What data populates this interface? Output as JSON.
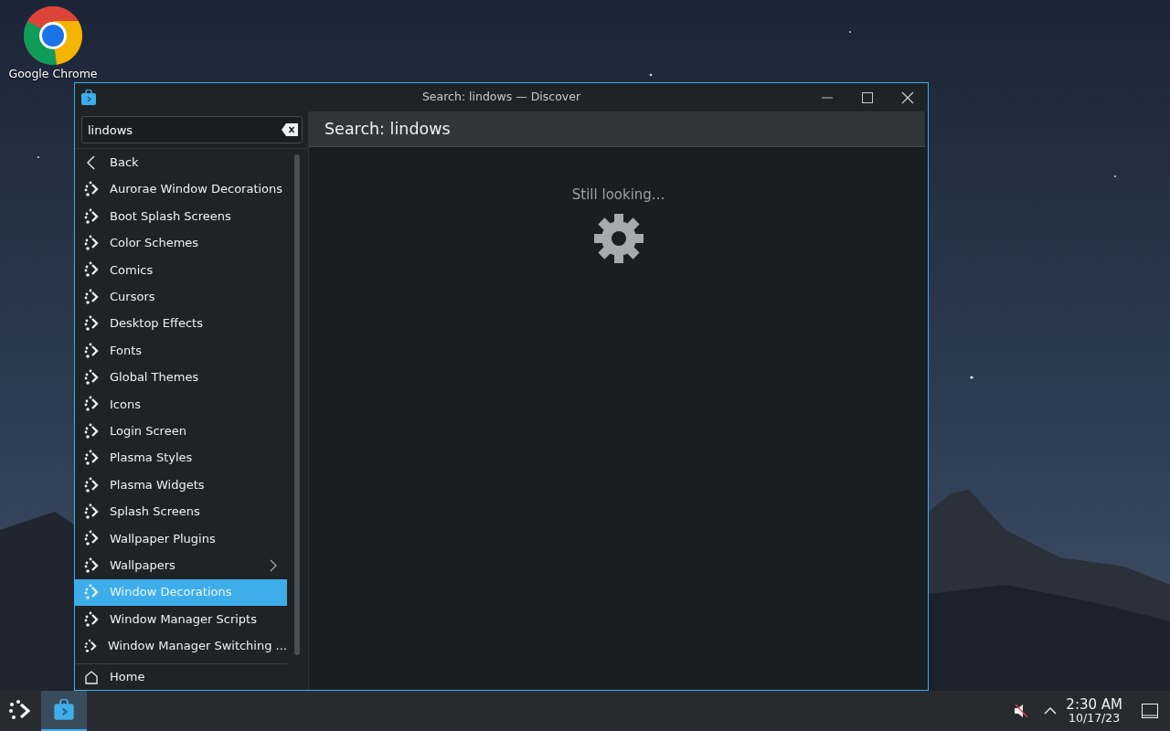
{
  "desktop_icons": [
    {
      "label": "Google Chrome"
    }
  ],
  "window": {
    "title": "Search: lindows — Discover",
    "search": {
      "value": "lindows"
    },
    "heading": "Search: lindows",
    "sidebar": {
      "back": "Back",
      "items": [
        {
          "label": "Aurorae Window Decorations",
          "selected": false,
          "has_children": false
        },
        {
          "label": "Boot Splash Screens",
          "selected": false,
          "has_children": false
        },
        {
          "label": "Color Schemes",
          "selected": false,
          "has_children": false
        },
        {
          "label": "Comics",
          "selected": false,
          "has_children": false
        },
        {
          "label": "Cursors",
          "selected": false,
          "has_children": false
        },
        {
          "label": "Desktop Effects",
          "selected": false,
          "has_children": false
        },
        {
          "label": "Fonts",
          "selected": false,
          "has_children": false
        },
        {
          "label": "Global Themes",
          "selected": false,
          "has_children": false
        },
        {
          "label": "Icons",
          "selected": false,
          "has_children": false
        },
        {
          "label": "Login Screen",
          "selected": false,
          "has_children": false
        },
        {
          "label": "Plasma Styles",
          "selected": false,
          "has_children": false
        },
        {
          "label": "Plasma Widgets",
          "selected": false,
          "has_children": false
        },
        {
          "label": "Splash Screens",
          "selected": false,
          "has_children": false
        },
        {
          "label": "Wallpaper Plugins",
          "selected": false,
          "has_children": false
        },
        {
          "label": "Wallpapers",
          "selected": false,
          "has_children": true
        },
        {
          "label": "Window Decorations",
          "selected": true,
          "has_children": false
        },
        {
          "label": "Window Manager Scripts",
          "selected": false,
          "has_children": false
        },
        {
          "label": "Window Manager Switching ...",
          "selected": false,
          "has_children": false
        }
      ],
      "home": "Home"
    },
    "status": "Still looking..."
  },
  "taskbar": {
    "time": "2:30 AM",
    "date": "10/17/23"
  }
}
